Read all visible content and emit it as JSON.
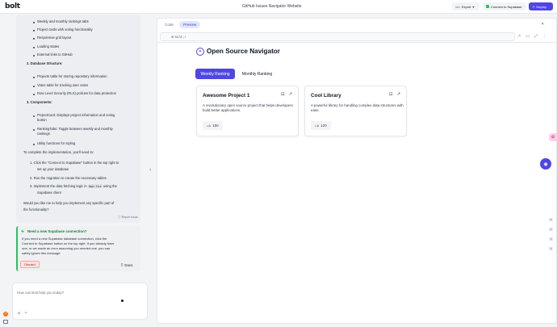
{
  "app": {
    "logo": "bolt",
    "window_title": "GitHub Issues Navigator Website"
  },
  "toolbar": {
    "export_label": "Export",
    "supabase_label": "Connect to Supabase",
    "deploy_label": "Deploy"
  },
  "chat": {
    "lines": {
      "l1": "Weekly and monthly rankings tabs",
      "l2": "Project cards with voting functionality",
      "l3": "Responsive grid layout",
      "l4": "Loading states",
      "l5": "External links to GitHub",
      "h2": "2. Database Structure:",
      "d1": "Projects table for storing repository information",
      "d2": "Votes table for tracking user votes",
      "d3": "Row Level Security (RLS) policies for data protection",
      "h3": "3. Components:",
      "c1a": "ProjectCard: Displays project information and voting",
      "c1b": "button",
      "c2a": "RankingTabs: Toggle between weekly and monthly",
      "c2b": "rankings",
      "c3": "Utility functions for styling",
      "intro": "To complete the implementation, you'll need to:",
      "s1a": "1. Click the \"Connect to Supabase\" button in the top right to",
      "s1b": "set up your database",
      "s2": "2. Run the migration to create the necessary tables",
      "s3a": "3. Implement the data fetching logic in",
      "s3code": "App.tsx",
      "s3b": "using the",
      "s3c": "Supabase client",
      "q1": "Would you like me to help you implement any specific part of",
      "q2": "the functionality?"
    },
    "report_label": "Report issue",
    "supabase_prompt": {
      "title": "Need a new Supabase connection?",
      "body1": "If you need a new Supabase database connection, click the",
      "body2": "Connect to Supabase button on the top right. If you already have",
      "body3": "one, or we made an error assuming you needed one, you can",
      "body4": "safely ignore this message.",
      "discard_label": "Discard",
      "docs_label": "Docs"
    },
    "input": {
      "placeholder": "How can Bolt help you today?"
    },
    "avatar_initial": "T"
  },
  "workbench": {
    "tabs": [
      {
        "label": "Code"
      },
      {
        "label": "Preview"
      }
    ],
    "address": {
      "port": "5173",
      "path": "/"
    }
  },
  "preview": {
    "title": "Open Source Navigator",
    "tabs": {
      "weekly": "Weekly Ranking",
      "monthly": "Monthly Ranking"
    },
    "projects": [
      {
        "name": "Awesome Project 1",
        "description": "A revolutionary open source project that helps developers build better applications.",
        "votes": "150"
      },
      {
        "name": "Cool Library",
        "description": "A powerful library for handling complex data structures with ease.",
        "votes": "120"
      }
    ]
  },
  "colors": {
    "accent": "#4f46e5",
    "supabase_green": "#22c55e",
    "danger": "#b91c1c"
  },
  "icons": [
    "bookmark-icon",
    "external-link-icon",
    "thumbs-up-icon",
    "book-icon",
    "compass-icon",
    "paperclip-icon",
    "chevron-left-icon"
  ]
}
